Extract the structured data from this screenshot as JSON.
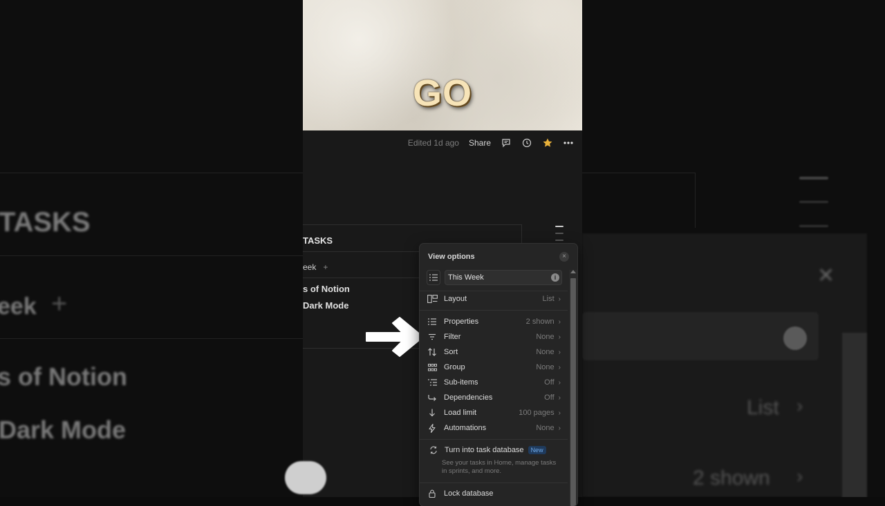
{
  "banner": {
    "word": "GO"
  },
  "topbar": {
    "edited": "Edited 1d ago",
    "share": "Share"
  },
  "database": {
    "title": "TASKS",
    "view_tab": "eek",
    "add_view": "+",
    "items": [
      "s of Notion",
      "Dark Mode"
    ]
  },
  "menu": {
    "title": "View options",
    "close": "×",
    "view_name": "This Week",
    "info": "i",
    "rows": [
      {
        "label": "Layout",
        "value": "List",
        "icon": "layout-icon"
      },
      {
        "label": "Properties",
        "value": "2 shown",
        "icon": "list-icon"
      },
      {
        "label": "Filter",
        "value": "None",
        "icon": "filter-icon"
      },
      {
        "label": "Sort",
        "value": "None",
        "icon": "sort-icon"
      },
      {
        "label": "Group",
        "value": "None",
        "icon": "group-icon"
      },
      {
        "label": "Sub-items",
        "value": "Off",
        "icon": "sub-items-icon"
      },
      {
        "label": "Dependencies",
        "value": "Off",
        "icon": "dependencies-icon"
      },
      {
        "label": "Load limit",
        "value": "100 pages",
        "icon": "down-arrow-icon"
      },
      {
        "label": "Automations",
        "value": "None",
        "icon": "lightning-icon"
      }
    ],
    "task_db": {
      "label": "Turn into task database",
      "badge": "New",
      "description": "See your tasks in Home, manage tasks in sprints, and more."
    },
    "lock": "Lock database"
  },
  "background": {
    "left_title": "TASKS",
    "left_tab": "eek",
    "left_item_1": "s of Notion",
    "left_item_2": "Dark Mode",
    "right_layout_value": "List",
    "right_properties_value": "2 shown"
  },
  "colors": {
    "accent_star": "#e8b13a",
    "badge_bg": "#1f3a5c",
    "badge_text": "#6ea8e6"
  }
}
